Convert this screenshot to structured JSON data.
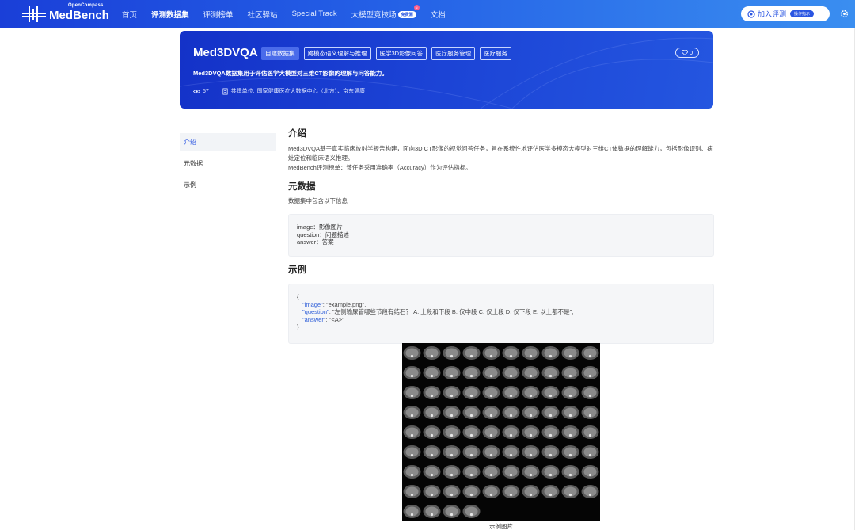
{
  "nav": {
    "logo_sub": "OpenCompass",
    "logo_main": "MedBench",
    "links": [
      {
        "label": "首页",
        "active": false
      },
      {
        "label": "评测数据集",
        "active": true
      },
      {
        "label": "评测榜单",
        "active": false
      },
      {
        "label": "社区驿站",
        "active": false
      },
      {
        "label": "Special Track",
        "active": false
      },
      {
        "label": "大模型竞技场",
        "active": false
      },
      {
        "label": "文档",
        "active": false
      }
    ],
    "arena_badge": "免费测",
    "arena_dot": "N",
    "join_label": "加入评测",
    "join_pill": "操作指示"
  },
  "hero": {
    "title": "Med3DVQA",
    "tags": [
      "自建数据集",
      "跨模态语义理解与推理",
      "医学3D影像问答",
      "医疗服务管理",
      "医疗服务"
    ],
    "like_count": "0",
    "description": "Med3DVQA数据集用于评估医学大模型对三维CT影像的理解与问答能力。",
    "views": "57",
    "co_builders_label": "共建单位:",
    "co_builders": "国家健康医疗大数据中心（北方）、京东健康"
  },
  "sidenav": {
    "items": [
      {
        "label": "介绍",
        "active": true
      },
      {
        "label": "元数据",
        "active": false
      },
      {
        "label": "示例",
        "active": false
      }
    ]
  },
  "intro": {
    "heading": "介绍",
    "para1": "Med3DVQA基于真实临床放射学报告构建，面向3D CT影像的视觉问答任务，旨在系统性地评估医学多模态大模型对三维CT体数据的理解能力，包括影像识别、病灶定位和临床语义推理。",
    "para2": "MedBench评测榜单：该任务采用准确率（Accuracy）作为评估指标。"
  },
  "metadata": {
    "heading": "元数据",
    "subtitle": "数据集中包含以下信息",
    "fields": [
      "image：影像图片",
      "question：问题描述",
      "answer：答案"
    ]
  },
  "example": {
    "heading": "示例",
    "open_brace": "{",
    "close_brace": "}",
    "lines": [
      {
        "key": "\"image\"",
        "value": ": \"example.png\","
      },
      {
        "key": "\"question\"",
        "value": ": \"左侧输尿管哪些节段有结石？ A. 上段和下段 B. 仅中段 C. 仅上段 D. 仅下段 E. 以上都不是\","
      },
      {
        "key": "\"answer\"",
        "value": ": \"<A>\""
      }
    ],
    "image_caption": "示例图片"
  }
}
